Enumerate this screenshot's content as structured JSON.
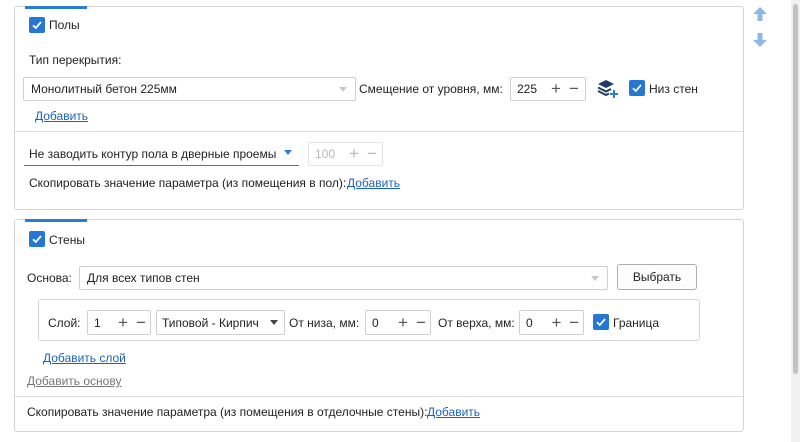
{
  "floors": {
    "section_title": "Полы",
    "checked": true,
    "slab_type_label": "Тип перекрытия:",
    "slab_type_value": "Монолитный бетон 225мм",
    "offset_label": "Смещение от уровня, мм:",
    "offset_value": "225",
    "bottom_walls_label": "Низ стен",
    "bottom_walls_checked": true,
    "add_link": "Добавить",
    "contour_option": "Не заводить контур пола в дверные проемы",
    "contour_value": "100",
    "copy_text": "Скопировать значение параметра (из помещения в пол):",
    "copy_link": "Добавить"
  },
  "walls": {
    "section_title": "Стены",
    "checked": true,
    "base_label": "Основа:",
    "base_value": "Для всех типов стен",
    "select_button": "Выбрать",
    "layer": {
      "layer_label": "Слой:",
      "layer_value": "1",
      "material_value": "Типовой - Кирпич",
      "from_bottom_label": "От низа, мм:",
      "from_bottom_value": "0",
      "from_top_label": "От верха, мм:",
      "from_top_value": "0",
      "border_label": "Граница",
      "border_checked": true
    },
    "add_layer_link": "Добавить слой",
    "add_base_link": "Добавить основу",
    "copy_text": "Скопировать значение параметра (из помещения в отделочные стены):",
    "copy_link": "Добавить"
  },
  "symbols": {
    "plus": "+",
    "minus": "−"
  },
  "icons": [
    "arrow-up-icon",
    "arrow-down-icon",
    "layers-add-icon",
    "checkbox-check-icon",
    "dropdown-arrow-icon"
  ],
  "colors": {
    "accent": "#2a7cd6",
    "checkbox": "#2677d2",
    "link": "#1b62c3",
    "arrow": "#8fb8e6"
  }
}
